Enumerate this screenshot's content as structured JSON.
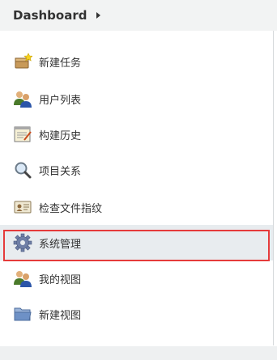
{
  "header": {
    "title": "Dashboard"
  },
  "sidebar": {
    "items": [
      {
        "label": "新建任务",
        "icon": "new-item-icon"
      },
      {
        "label": "用户列表",
        "icon": "users-icon"
      },
      {
        "label": "构建历史",
        "icon": "notepad-icon"
      },
      {
        "label": "项目关系",
        "icon": "search-icon"
      },
      {
        "label": "检查文件指纹",
        "icon": "fingerprint-card-icon"
      },
      {
        "label": "系统管理",
        "icon": "gear-icon"
      },
      {
        "label": "我的视图",
        "icon": "user-icon"
      },
      {
        "label": "新建视图",
        "icon": "folder-icon"
      }
    ],
    "selected": "系统管理"
  },
  "colors": {
    "highlight": "#e53b3b",
    "header_bg": "#f2f3f3"
  }
}
